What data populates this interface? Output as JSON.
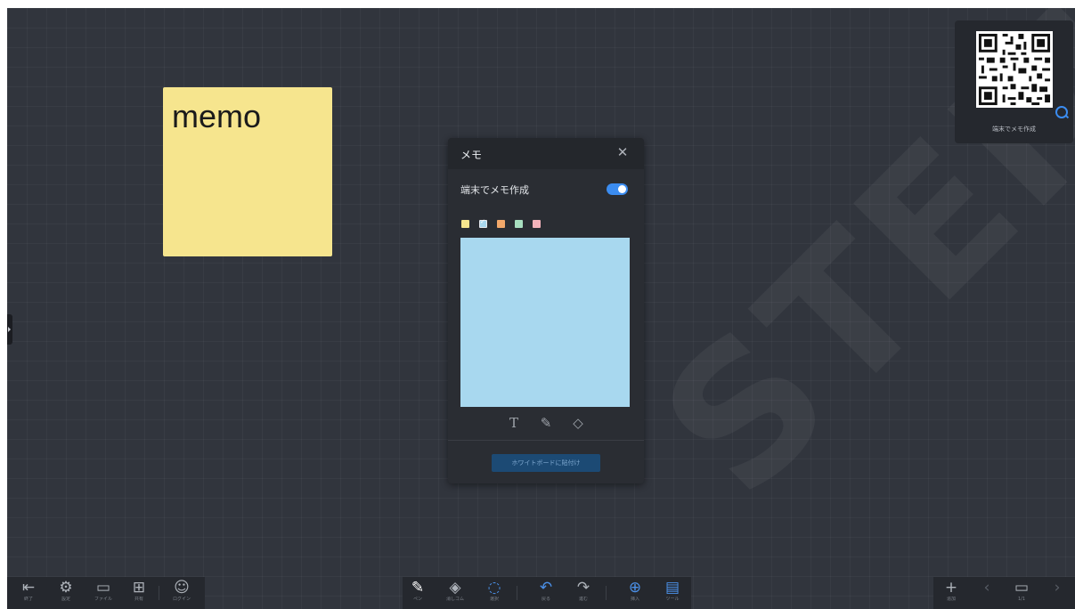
{
  "sticky_note": {
    "text": "memo",
    "color": "#f6e58e"
  },
  "qr_panel": {
    "label": "端末でメモ作成",
    "icon": "zoom-icon"
  },
  "memo_dialog": {
    "title": "メモ",
    "close_icon": "close-icon",
    "toggle_label": "端末でメモ作成",
    "toggle_on": true,
    "colors": [
      {
        "name": "yellow",
        "hex": "#f6e58e",
        "selected": false
      },
      {
        "name": "blue",
        "hex": "#a8d8ef",
        "selected": true
      },
      {
        "name": "orange",
        "hex": "#f3a86a",
        "selected": false
      },
      {
        "name": "green",
        "hex": "#a8dfc0",
        "selected": false
      },
      {
        "name": "pink",
        "hex": "#f3b3bb",
        "selected": false
      }
    ],
    "preview_color": "#a8d8ef",
    "tools": [
      "text-icon",
      "pen-icon",
      "eraser-icon"
    ],
    "paste_button": "ホワイトボードに貼付け"
  },
  "bottom_left": [
    {
      "icon": "exit-icon",
      "label": "終了"
    },
    {
      "icon": "settings-icon",
      "label": "設定"
    },
    {
      "icon": "folder-icon",
      "label": "ファイル"
    },
    {
      "icon": "share-icon",
      "label": "共有"
    },
    {
      "icon": "user-icon",
      "label": "ログイン"
    }
  ],
  "bottom_center": [
    {
      "icon": "pen-icon",
      "label": "ペン"
    },
    {
      "icon": "eraser-icon",
      "label": "消しゴム"
    },
    {
      "icon": "select-icon",
      "label": "選択"
    },
    {
      "icon": "undo-icon",
      "label": "戻る"
    },
    {
      "icon": "redo-icon",
      "label": "進む"
    },
    {
      "icon": "insert-icon",
      "label": "挿入"
    },
    {
      "icon": "tools-icon",
      "label": "ツール"
    }
  ],
  "bottom_right": [
    {
      "icon": "add-page-icon",
      "label": "追加"
    },
    {
      "icon": "prev-page-icon",
      "label": ""
    },
    {
      "icon": "pages-icon",
      "label": "1/1"
    },
    {
      "icon": "next-page-icon",
      "label": ""
    }
  ],
  "watermark": "STEM"
}
